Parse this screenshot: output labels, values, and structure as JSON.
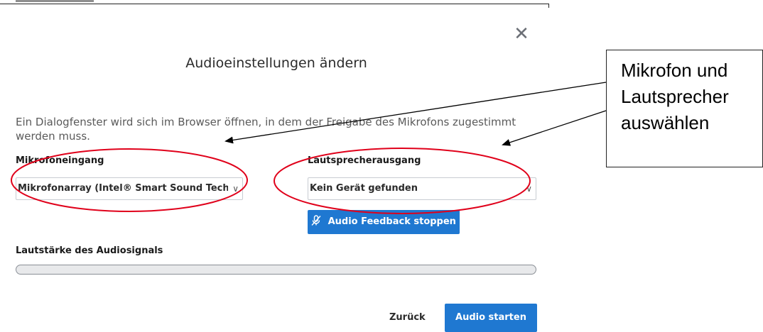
{
  "dialog": {
    "title": "Audioeinstellungen ändern",
    "close_icon": "close-icon",
    "description": "Ein Dialogfenster wird sich im Browser öffnen, in dem der Freigabe des Mikrofons zugestimmt werden muss."
  },
  "microphone": {
    "label": "Mikrofoneingang",
    "selected": "Mikrofonarray (Intel® Smart Sound Technology",
    "icon": "chevron-down-icon"
  },
  "speaker": {
    "label": "Lautsprecherausgang",
    "selected": "Kein Gerät gefunden",
    "icon": "chevron-down-icon"
  },
  "feedback_button": {
    "label": "Audio Feedback stoppen",
    "icon": "microphone-off-icon"
  },
  "volume": {
    "label": "Lautstärke des Audiosignals",
    "level": 0
  },
  "footer": {
    "back_label": "Zurück",
    "start_label": "Audio starten"
  },
  "callout": {
    "lines": [
      "Mikrofon und",
      "Lautsprecher",
      "auswählen"
    ]
  },
  "colors": {
    "primary_button": "#1f78d1",
    "annotation_red": "#e0001a",
    "annotation_arrow": "#000000"
  }
}
